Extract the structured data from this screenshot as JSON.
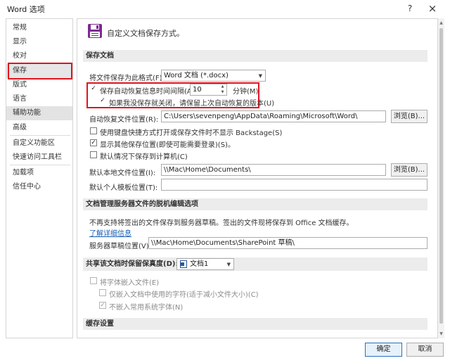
{
  "window": {
    "title": "Word 选项",
    "help": "?",
    "close": "×"
  },
  "sidebar": {
    "items": [
      {
        "label": "常规"
      },
      {
        "label": "显示"
      },
      {
        "label": "校对"
      },
      {
        "label": "保存"
      },
      {
        "label": "版式"
      },
      {
        "label": "语言"
      },
      {
        "label": "辅助功能"
      },
      {
        "label": "高级"
      },
      {
        "label": "自定义功能区"
      },
      {
        "label": "快速访问工具栏"
      },
      {
        "label": "加载项"
      },
      {
        "label": "信任中心"
      }
    ]
  },
  "header": {
    "title": "自定义文档保存方式。"
  },
  "save_docs": {
    "section_title": "保存文档",
    "format_label": "将文件保存为此格式(F):",
    "format_value": "Word 文档 (*.docx)",
    "autorecover_label": "保存自动恢复信息时间间隔(A)",
    "autorecover_checked": "✓",
    "autorecover_minutes": "10",
    "minutes_label": "分钟(M)",
    "keep_last_label": "如果我没保存就关闭，请保留上次自动恢复的版本(U)",
    "keep_last_checked": "✓",
    "autorecover_location_label": "自动恢复文件位置(R):",
    "autorecover_location_value": "C:\\Users\\sevenpeng\\AppData\\Roaming\\Microsoft\\Word\\",
    "browse_label": "浏览(B)...",
    "backstage_label": "使用键盘快捷方式打开或保存文件时不显示 Backstage(S)",
    "backstage_checked": "",
    "show_more_label": "显示其他保存位置(即使可能需要登录)(S)。",
    "show_more_checked": "✓",
    "save_to_computer_label": "默认情况下保存到计算机(C)",
    "save_to_computer_checked": "",
    "local_location_label": "默认本地文件位置(I):",
    "local_location_value": "\\\\Mac\\Home\\Documents\\",
    "browse2_label": "浏览(B)...",
    "template_location_label": "默认个人模板位置(T):",
    "template_location_value": ""
  },
  "offline": {
    "section_title": "文档管理服务器文件的脱机编辑选项",
    "note": "不再支持将签出的文件保存到服务器草稿。签出的文件现将保存到 Office 文档缓存。",
    "learn_more": "了解详细信息",
    "drafts_label": "服务器草稿位置(V):",
    "drafts_value": "\\\\Mac\\Home\\Documents\\SharePoint 草稿\\"
  },
  "fidelity": {
    "section_title": "共享该文档时保留保真度(D):",
    "doc_value": "文档1",
    "embed_fonts_label": "将字体嵌入文件(E)",
    "embed_fonts_checked": "",
    "embed_used_label": "仅嵌入文档中使用的字符(适于减小文件大小)(C)",
    "embed_used_checked": "",
    "no_common_label": "不嵌入常用系统字体(N)",
    "no_common_checked": "✓"
  },
  "cache": {
    "section_title": "缓存设置"
  },
  "footer": {
    "ok": "确定",
    "cancel": "取消"
  },
  "colors": {
    "highlight": "#e0141e",
    "accent": "#2b6fc0",
    "floppy": "#7b2c8f"
  }
}
